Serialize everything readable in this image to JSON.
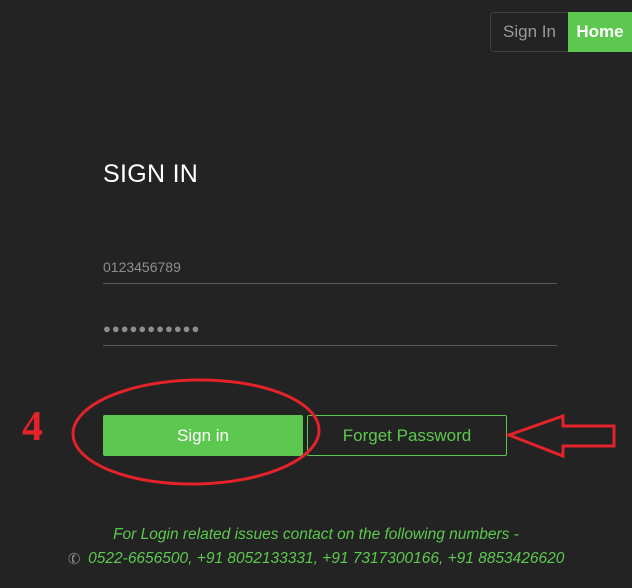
{
  "nav": {
    "signin_label": "Sign In",
    "home_label": "Home"
  },
  "form": {
    "title": "SIGN IN",
    "username_placeholder": "0123456789",
    "password_value": "●●●●●●●●●●●",
    "signin_button": "Sign in",
    "forget_button": "Forget Password"
  },
  "annotation": {
    "step_number": "4",
    "color": "#e3222a"
  },
  "footer": {
    "line1": "For Login related issues contact on the following numbers -",
    "line2": "0522-6656500, +91 8052133331, +91 7317300166, +91 8853426620",
    "icon": "phone-icon"
  },
  "colors": {
    "background": "#232323",
    "accent": "#5dc84f"
  }
}
